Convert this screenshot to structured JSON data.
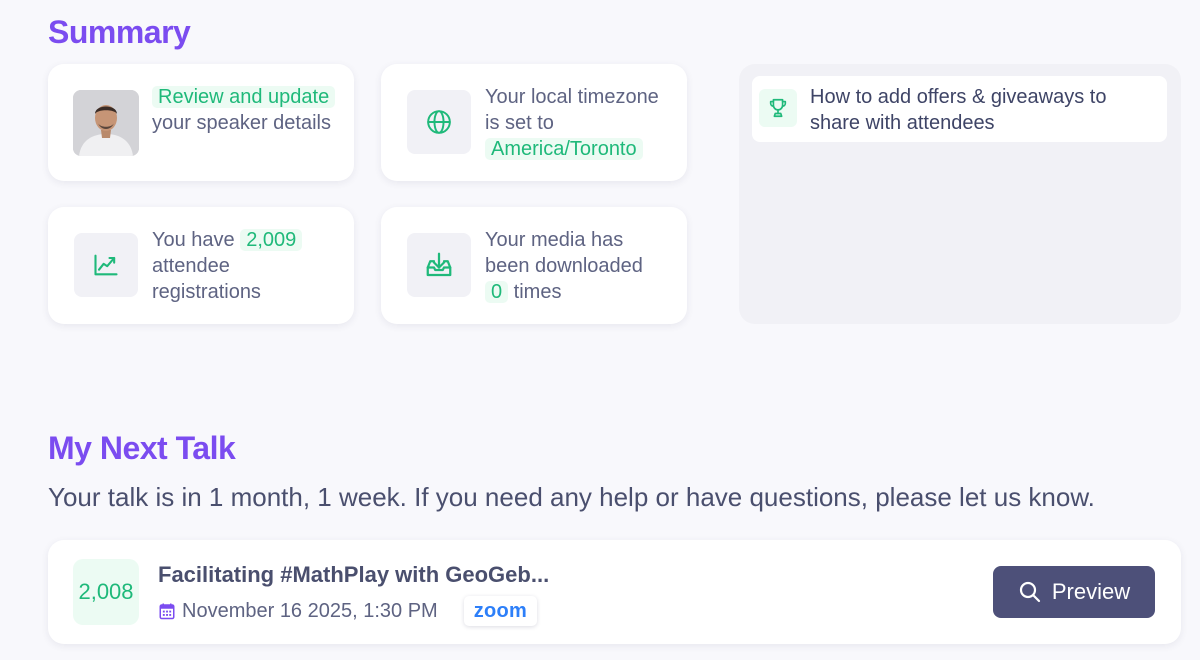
{
  "summary": {
    "title": "Summary",
    "speaker_card": {
      "link": "Review and update",
      "rest": " your speaker details"
    },
    "timezone_card": {
      "prefix": "Your local timezone is set to ",
      "value": "America/Toronto"
    },
    "registrations_card": {
      "prefix": "You have ",
      "count": "2,009",
      "suffix": " attendee registrations"
    },
    "media_card": {
      "prefix": "Your media has been downloaded ",
      "count": "0",
      "suffix": " times"
    },
    "offers_link": {
      "label": "How to add offers & giveaways to share with attendees",
      "icon": "trophy-icon"
    }
  },
  "next_talk": {
    "title": "My Next Talk",
    "subtitle": "Your talk is in 1 month, 1 week. If you need any help or have questions, please let us know.",
    "talk": {
      "registrations": "2,008",
      "title": "Facilitating #MathPlay with GeoGeb...",
      "date": "November 16 2025, 1:30 PM",
      "platform": "zoom",
      "preview_label": "Preview"
    }
  },
  "colors": {
    "heading": "#7b4cf0",
    "accent_green": "#1fb97a",
    "accent_green_bg": "#ecfbf3",
    "button_bg": "#4d5079",
    "zoom_blue": "#2d7ff9"
  }
}
